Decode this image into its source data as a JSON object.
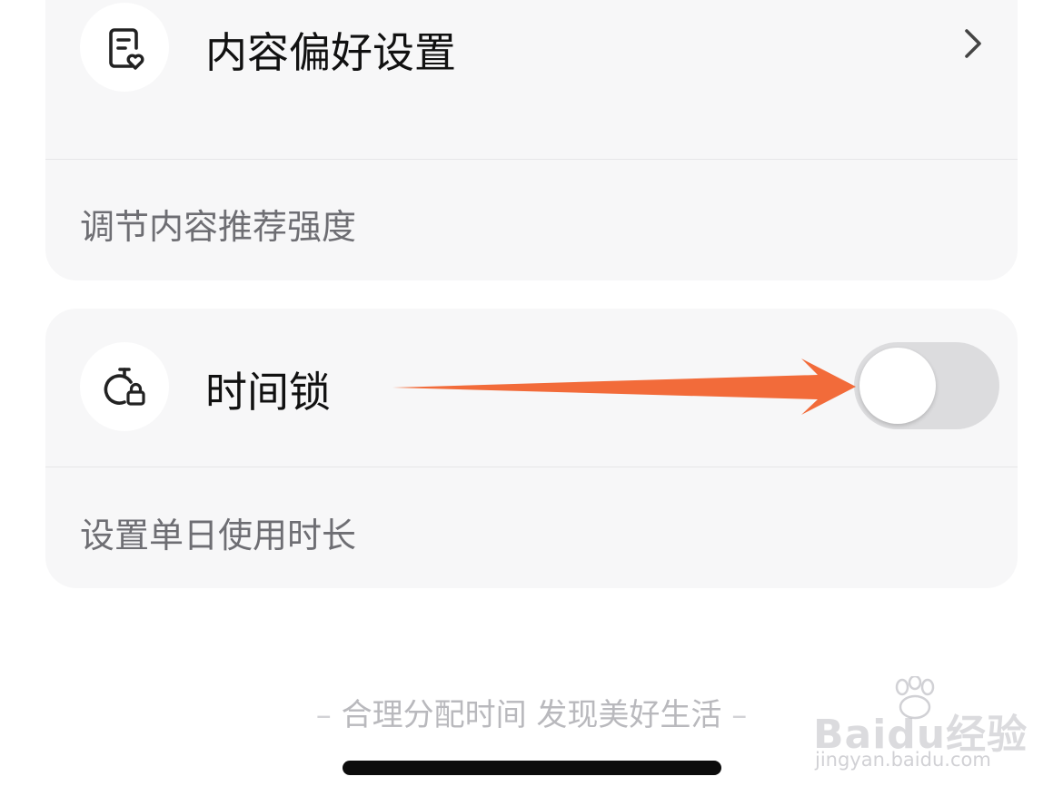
{
  "content_preference": {
    "icon": "document-heart-icon",
    "title": "内容偏好设置",
    "chevron_icon": "chevron-right-icon",
    "subtitle": "调节内容推荐强度"
  },
  "time_lock": {
    "icon": "timer-lock-icon",
    "title": "时间锁",
    "toggle_on": false,
    "subtitle": "设置单日使用时长"
  },
  "annotation": {
    "arrow_color": "#f26b3a"
  },
  "footer": {
    "dash": "–",
    "slogan": "合理分配时间 发现美好生活"
  },
  "watermark": {
    "logo_text": "Baidu经验",
    "url": "jingyan.baidu.com"
  }
}
